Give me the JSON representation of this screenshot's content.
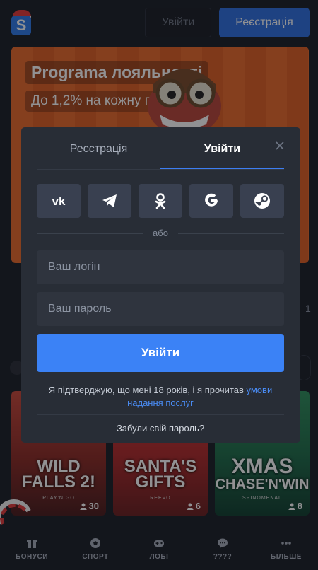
{
  "header": {
    "logo_letter": "S",
    "login_label": "Увійти",
    "register_label": "Реєстрація"
  },
  "banner": {
    "title": "Programa лояльності",
    "subtitle": "До 1,2% на кожну перемогу!"
  },
  "side_digit": "1",
  "games": [
    {
      "title_line1": "WILD",
      "title_line2": "FALLS 2!",
      "provider": "PLAY'N GO",
      "players": "30"
    },
    {
      "title_line1": "SANTA'S",
      "title_line2": "GIFTS",
      "provider": "REEVO",
      "players": "6"
    },
    {
      "title_line1": "XMAS",
      "title_line2": "CHASE'N'WIN",
      "provider": "SPINOMENAL",
      "players": "8"
    }
  ],
  "bottom_nav": [
    {
      "label": "БОНУСИ",
      "icon": "gift-icon"
    },
    {
      "label": "СПОРТ",
      "icon": "soccer-ball-icon"
    },
    {
      "label": "ЛОБІ",
      "icon": "gamepad-icon"
    },
    {
      "label": "????",
      "icon": "chat-icon"
    },
    {
      "label": "БІЛЬШЕ",
      "icon": "more-dots-icon"
    }
  ],
  "modal": {
    "tab_register": "Реєстрація",
    "tab_login": "Увійти",
    "socials": [
      "vk-icon",
      "telegram-icon",
      "odnoklassniki-icon",
      "google-icon",
      "steam-icon"
    ],
    "divider_text": "або",
    "login_placeholder": "Ваш логін",
    "password_placeholder": "Ваш пароль",
    "submit_label": "Увійти",
    "terms_text": "Я підтверджую, що мені 18 років, і я прочитав ",
    "terms_link": "умови надання послуг",
    "forgot_label": "Забули свій пароль?"
  },
  "colors": {
    "background": "#1b1f27",
    "modal": "#282d36",
    "accent": "#3b82f6",
    "banner": "#e96a2b"
  }
}
